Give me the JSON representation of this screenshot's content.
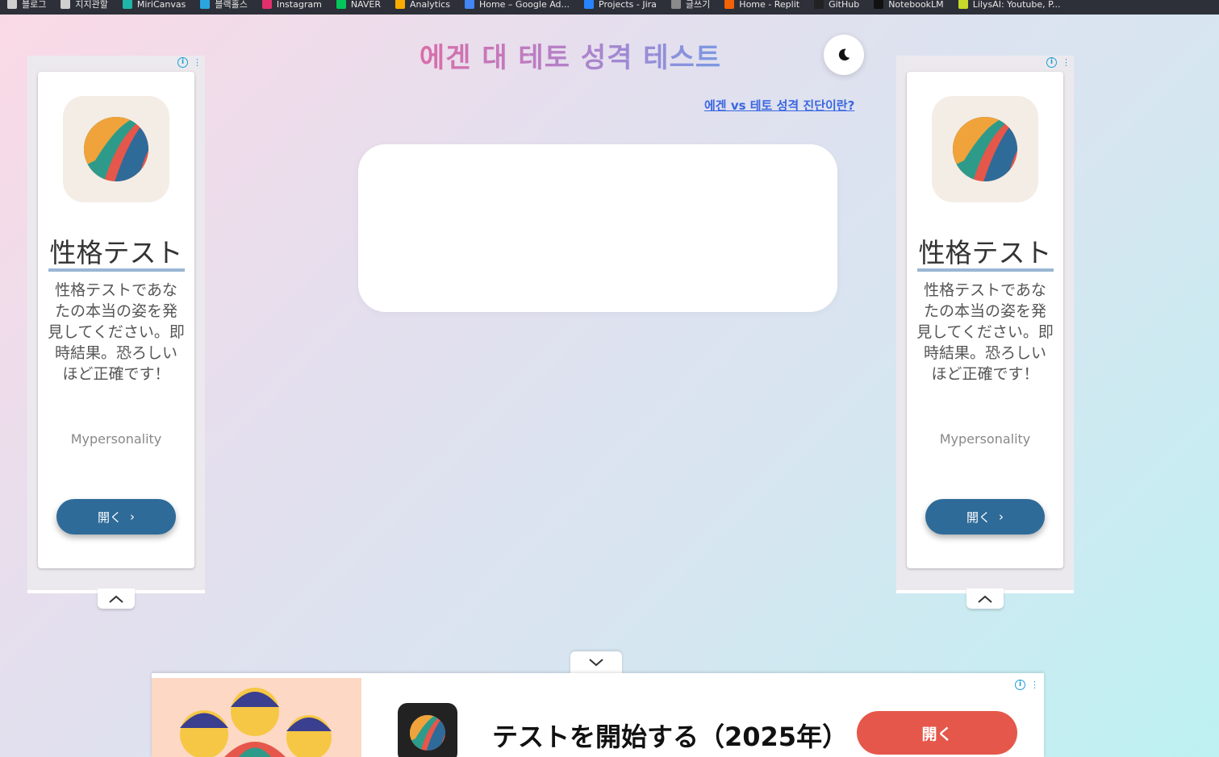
{
  "bookmarks": [
    {
      "label": "블로그",
      "icon": "page-icon",
      "color": "#cfcfcf"
    },
    {
      "label": "지지관할",
      "icon": "page-icon",
      "color": "#cfcfcf"
    },
    {
      "label": "MiriCanvas",
      "icon": "miricanvas-icon",
      "color": "#1fb5a8"
    },
    {
      "label": "블랙홀스",
      "icon": "bird-icon",
      "color": "#2aa5e0"
    },
    {
      "label": "Instagram",
      "icon": "instagram-icon",
      "color": "#e1306c"
    },
    {
      "label": "NAVER",
      "icon": "naver-icon",
      "color": "#03c75a"
    },
    {
      "label": "Analytics",
      "icon": "analytics-icon",
      "color": "#f9ab00"
    },
    {
      "label": "Home – Google Ad...",
      "icon": "google-ads-icon",
      "color": "#4285f4"
    },
    {
      "label": "Projects - Jira",
      "icon": "jira-icon",
      "color": "#2684ff"
    },
    {
      "label": "글쓰기",
      "icon": "qr-icon",
      "color": "#8a8a8a"
    },
    {
      "label": "Home - Replit",
      "icon": "replit-icon",
      "color": "#f26207"
    },
    {
      "label": "GitHub",
      "icon": "github-icon",
      "color": "#222222"
    },
    {
      "label": "NotebookLM",
      "icon": "notebooklm-icon",
      "color": "#111111"
    },
    {
      "label": "LilysAI: Youtube, P...",
      "icon": "lilys-icon",
      "color": "#c9d82a"
    }
  ],
  "header": {
    "title": "에겐 대 테토 성격 테스트",
    "theme_icon": "moon-icon",
    "info_link": "에겐 vs 테토 성격 진단이란?"
  },
  "side_ad": {
    "headline": "性格テスト",
    "description": "性格テストであなたの本当の姿を発見してください。即時結果。恐ろしいほど正確です！",
    "brand": "Mypersonality",
    "open_label": "開く"
  },
  "bottom_ad": {
    "headline": "テストを開始する（2025年）",
    "open_label": "開く"
  },
  "colors": {
    "ad_button": "#2e6b99",
    "bottom_button": "#e5574a",
    "link": "#3a66e0",
    "adchoices": "#19a0d8"
  }
}
